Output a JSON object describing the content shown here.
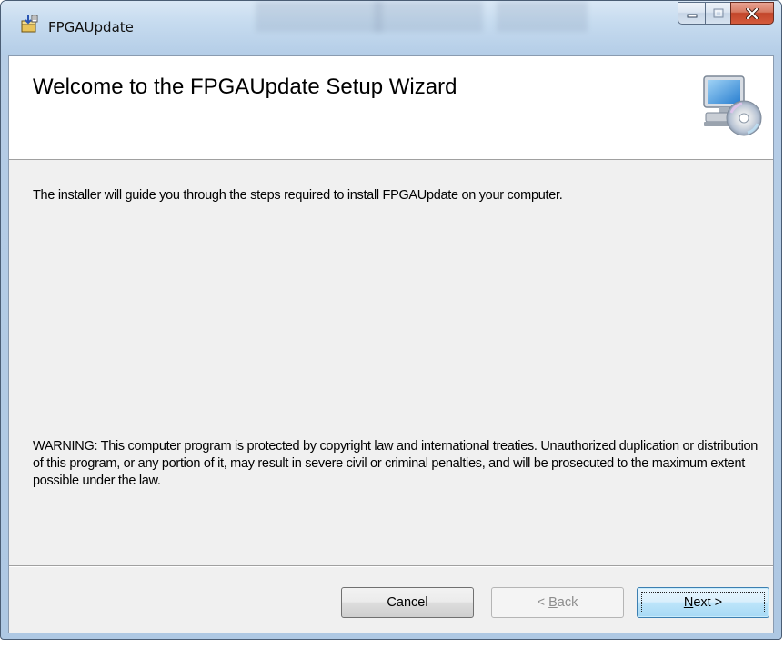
{
  "window": {
    "title": "FPGAUpdate",
    "app_icon": "installer-package-icon",
    "caption_buttons": {
      "minimize_icon": "minimize-icon",
      "maximize_icon": "maximize-icon",
      "close_icon": "close-icon"
    }
  },
  "banner": {
    "title": "Welcome to the FPGAUpdate Setup Wizard",
    "icon": "computer-cd-icon"
  },
  "content": {
    "intro": "The installer will guide you through the steps required to install FPGAUpdate on your computer.",
    "warning": "WARNING: This computer program is protected by copyright law and international treaties. Unauthorized duplication or distribution of this program, or any portion of it, may result in severe civil or criminal penalties, and will be prosecuted to the maximum extent possible under the law."
  },
  "buttons": {
    "cancel": "Cancel",
    "back_prefix": "< ",
    "back_mnemonic": "B",
    "back_rest": "ack",
    "next_mnemonic": "N",
    "next_rest": "ext >"
  },
  "colors": {
    "titlebar": "#c6dbef",
    "close_button": "#c2452a",
    "dialog_background": "#f0f0f0",
    "banner_background": "#ffffff",
    "default_button": "#bde5fa"
  }
}
